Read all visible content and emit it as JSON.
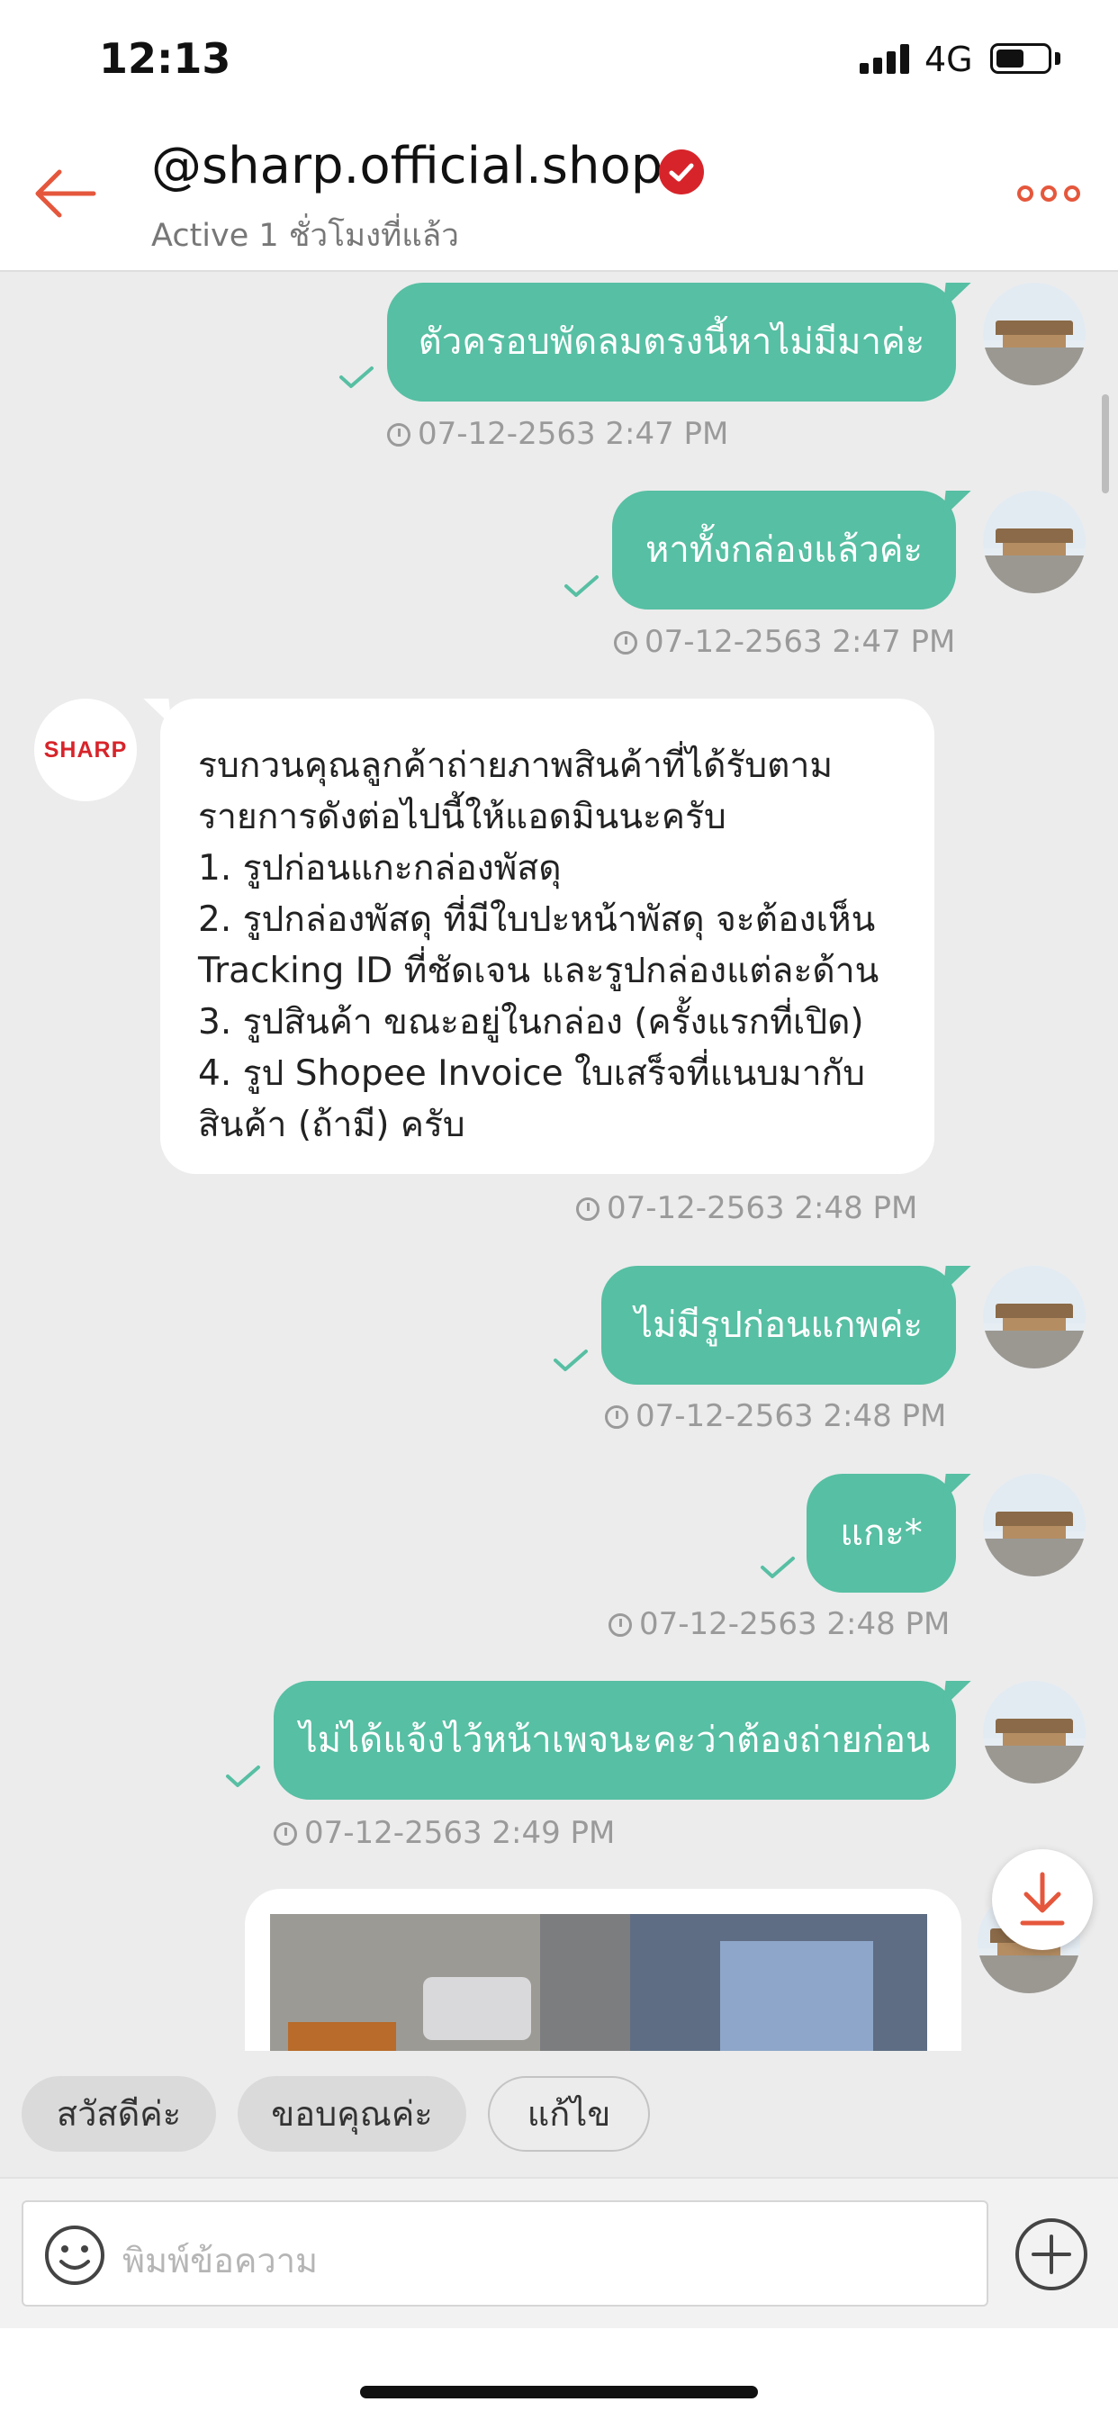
{
  "status_bar": {
    "time": "12:13",
    "network": "4G",
    "battery_level": 0.55
  },
  "header": {
    "shop_name": "@sharp.official.shop",
    "active_status": "Active 1 ชั่วโมงที่แล้ว"
  },
  "shop_logo_text": "SHARP",
  "messages": [
    {
      "text": "ตัวครอบพัดลมตรงนี้หาไม่มีมาค่ะ",
      "time": "07-12-2563 2:47 PM"
    },
    {
      "text": "หาทั้งกล่องแล้วค่ะ",
      "time": "07-12-2563 2:47 PM"
    },
    {
      "lines": [
        "รบกวนคุณลูกค้าถ่ายภาพสินค้าที่ได้รับตาม",
        "รายการดังต่อไปนี้ให้แอดมินนะครับ",
        "1. รูปก่อนแกะกล่องพัสดุ",
        "2. รูปกล่องพัสดุ ที่มีใบปะหน้าพัสดุ จะต้องเห็น",
        "Tracking ID ที่ชัดเจน และรูปกล่องแต่ละด้าน",
        "3. รูปสินค้า ขณะอยู่ในกล่อง (ครั้งแรกที่เปิด)",
        "4. รูป Shopee Invoice ใบเสร็จที่แนบมากับ",
        "สินค้า (ถ้ามี) ครับ"
      ],
      "time": "07-12-2563 2:48 PM"
    },
    {
      "text": "ไม่มีรูปก่อนแกพค่ะ",
      "time": "07-12-2563 2:48 PM"
    },
    {
      "text": "แกะ*",
      "time": "07-12-2563 2:48 PM"
    },
    {
      "text": "ไม่ได้แจ้งไว้หน้าเพจนะคะว่าต้องถ่ายก่อน",
      "time": "07-12-2563 2:49 PM"
    }
  ],
  "quick_replies": [
    "สวัสดีค่ะ",
    "ขอบคุณค่ะ",
    "แก้ไข"
  ],
  "input": {
    "placeholder": "พิมพ์ข้อความ"
  },
  "colors": {
    "accent": "#e5573c",
    "bubble_out": "#57bfa3",
    "verified": "#d7242a",
    "background": "#ececec"
  }
}
